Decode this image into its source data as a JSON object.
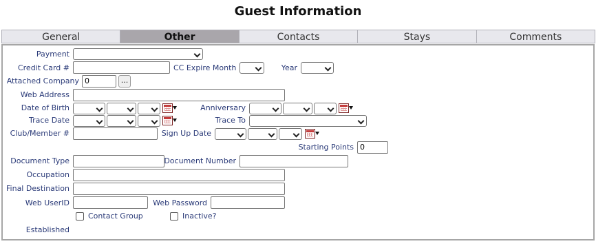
{
  "title": "Guest Information",
  "tabs": [
    "General",
    "Other",
    "Contacts",
    "Stays",
    "Comments"
  ],
  "active_tab": "Other",
  "labels": {
    "payment": "Payment",
    "credit_card": "Credit Card #",
    "cc_expire_month": "CC Expire Month",
    "year": "Year",
    "attached_company": "Attached Company",
    "web_address": "Web Address",
    "date_of_birth": "Date of Birth",
    "anniversary": "Anniversary",
    "trace_date": "Trace Date",
    "trace_to": "Trace To",
    "club_member": "Club/Member #",
    "sign_up_date": "Sign Up Date",
    "starting_points": "Starting Points",
    "document_type": "Document Type",
    "document_number": "Document Number",
    "occupation": "Occupation",
    "final_destination": "Final Destination",
    "web_userid": "Web UserID",
    "web_password": "Web Password",
    "contact_group": "Contact Group",
    "inactive": "Inactive?",
    "established": "Established"
  },
  "values": {
    "attached_company": "0",
    "starting_points": "0"
  },
  "buttons": {
    "browse": "..."
  },
  "checkboxes": {
    "contact_group": false,
    "inactive": false
  },
  "icons": {
    "calendar": "calendar-icon",
    "dropdown": "chevron-down-icon"
  },
  "colors": {
    "label": "#2a3a78",
    "active_tab": "#a9a6ab",
    "tab": "#e8e8ed",
    "calendar": "#c43b3b"
  }
}
